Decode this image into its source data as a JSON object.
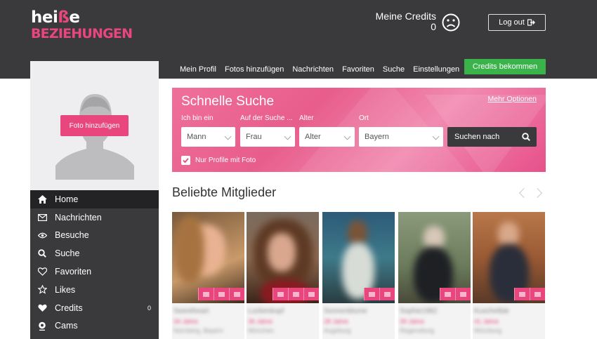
{
  "brand": {
    "line1_a": "hei",
    "line1_heart": "ß",
    "line1_b": "e",
    "line2": "BEZIEHUNGEN"
  },
  "header": {
    "credits_label": "Meine Credits",
    "credits_value": "0",
    "logout_label": "Log out"
  },
  "nav": {
    "items": [
      "Mein Profil",
      "Fotos hinzufügen",
      "Nachrichten",
      "Favoriten",
      "Suche",
      "Einstellungen"
    ],
    "cta": "Credits bekommen"
  },
  "sidebar": {
    "add_photo": "Foto hinzufügen",
    "items": [
      {
        "label": "Home",
        "icon": "home-icon"
      },
      {
        "label": "Nachrichten",
        "icon": "envelope-icon"
      },
      {
        "label": "Besuche",
        "icon": "eye-icon"
      },
      {
        "label": "Suche",
        "icon": "search-icon"
      },
      {
        "label": "Favoriten",
        "icon": "heart-outline-icon"
      },
      {
        "label": "Likes",
        "icon": "star-icon"
      },
      {
        "label": "Credits",
        "icon": "heart-icon",
        "badge": "0"
      },
      {
        "label": "Cams",
        "icon": "webcam-icon"
      }
    ]
  },
  "quick_search": {
    "title": "Schnelle Suche",
    "more_options": "Mehr Optionen",
    "labels": [
      "Ich bin ein",
      "Auf der Suche ...",
      "Alter",
      "Ort"
    ],
    "fields": [
      "Mann",
      "Frau",
      "Alter",
      "Bayern"
    ],
    "button": "Suchen nach",
    "checkbox_label": "Nur Profile mit Foto"
  },
  "members": {
    "title": "Beliebte Mitglieder",
    "cards": [
      {
        "name": "Sweetheart",
        "age": "34 Jahre",
        "loc": "Nürnberg, Bayern"
      },
      {
        "name": "Lockenkopf",
        "age": "36 Jahre",
        "loc": "München"
      },
      {
        "name": "Sonnenblume",
        "age": "28 Jahre",
        "loc": "Augsburg"
      },
      {
        "name": "Sophie1982",
        "age": "39 Jahre",
        "loc": "Regensburg"
      },
      {
        "name": "Kuschelbär",
        "age": "41 Jahre",
        "loc": "Würzburg"
      }
    ]
  },
  "colors": {
    "accent": "#e8467c",
    "dark": "#3a3a3d",
    "green": "#3ab34a"
  }
}
